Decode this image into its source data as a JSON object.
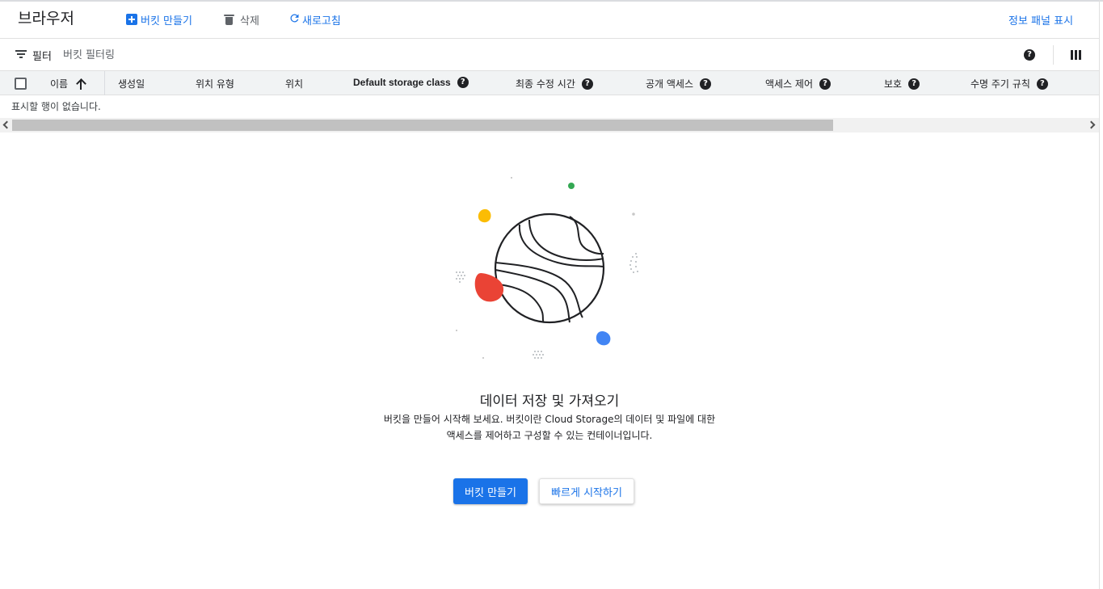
{
  "header": {
    "title": "브라우저",
    "create_bucket": "버킷 만들기",
    "delete": "삭제",
    "refresh": "새로고침",
    "show_info_panel": "정보 패널 표시"
  },
  "filter": {
    "label": "필터",
    "placeholder": "버킷 필터링"
  },
  "table": {
    "columns": [
      "이름",
      "생성일",
      "위치 유형",
      "위치",
      "Default storage class",
      "최종 수정 시간",
      "공개 액세스",
      "액세스 제어",
      "보호",
      "수명 주기 규칙"
    ],
    "empty_message": "표시할 행이 없습니다."
  },
  "empty_state": {
    "title": "데이터 저장 및 가져오기",
    "description_line1": "버킷을 만들어 시작해 보세요. 버킷이란 Cloud Storage의 데이터 및 파일에 대한",
    "description_line2": "액세스를 제어하고 구성할 수 있는 컨테이너입니다.",
    "primary_button": "버킷 만들기",
    "secondary_button": "빠르게 시작하기"
  },
  "colors": {
    "accent": "#1a73e8",
    "red": "#ea4335",
    "yellow": "#fbbc04",
    "green": "#34a853",
    "blue": "#4285f4"
  },
  "icons": [
    "add-box-icon",
    "trash-icon",
    "refresh-icon",
    "filter-icon",
    "help-icon",
    "columns-icon",
    "sort-ascending-icon",
    "scroll-left-icon",
    "scroll-right-icon",
    "globe-illustration"
  ]
}
